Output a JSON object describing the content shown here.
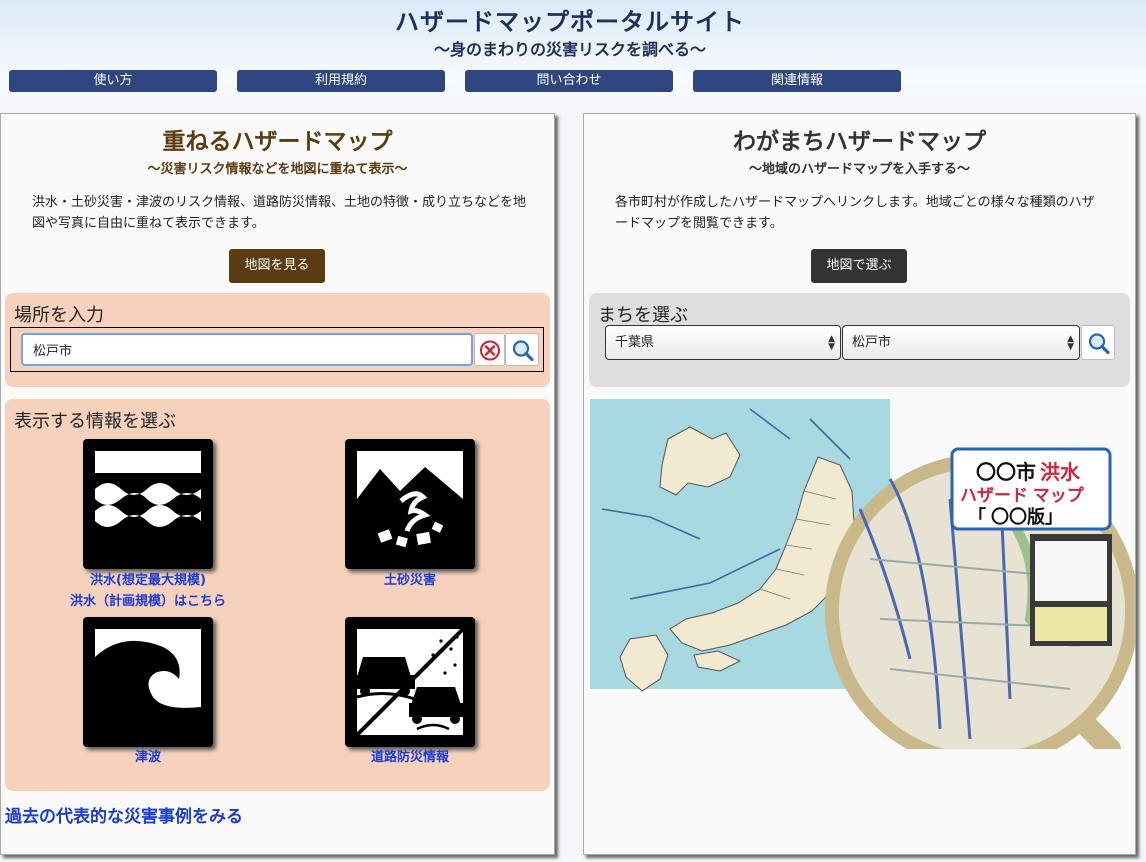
{
  "header": {
    "title": "ハザードマップポータルサイト",
    "subtitle": "〜身のまわりの災害リスクを調べる〜",
    "nav": [
      "使い方",
      "利用規約",
      "問い合わせ",
      "関連情報"
    ]
  },
  "left_panel": {
    "title": "重ねるハザードマップ",
    "subtitle": "〜災害リスク情報などを地図に重ねて表示〜",
    "description": "洪水・土砂災害・津波のリスク情報、道路防災情報、土地の特徴・成り立ちなどを地図や写真に自由に重ねて表示できます。",
    "map_button": "地図を見る",
    "place_box": {
      "title": "場所を入力",
      "input_value": "松戸市",
      "clear_icon": "clear-icon",
      "search_icon": "search-icon"
    },
    "info_box": {
      "title": "表示する情報を選ぶ",
      "items": [
        {
          "label": "洪水(想定最大規模)",
          "label2": "洪水（計画規模）はこちら",
          "icon": "flood-icon"
        },
        {
          "label": "土砂災害",
          "icon": "landslide-icon"
        },
        {
          "label": "津波",
          "icon": "tsunami-icon"
        },
        {
          "label": "道路防災情報",
          "icon": "road-disaster-icon"
        }
      ]
    },
    "past_link": "過去の代表的な災害事例をみる"
  },
  "right_panel": {
    "title": "わがまちハザードマップ",
    "subtitle": "〜地域のハザードマップを入手する〜",
    "description": "各市町村が作成したハザードマップへリンクします。地域ごとの様々な種類のハザードマップを閲覧できます。",
    "map_button": "地図で選ぶ",
    "town_box": {
      "title": "まちを選ぶ",
      "prefecture": "千葉県",
      "city": "松戸市",
      "search_icon": "search-icon"
    },
    "map_image": {
      "sign_line1_a": "〇〇市",
      "sign_line1_b": "洪水",
      "sign_line2": "ハザード マップ",
      "sign_line3": "「 〇〇版」"
    }
  },
  "colors": {
    "nav_button": "#2f4580",
    "left_title": "#5b3c10",
    "left_button": "#5b3c10",
    "right_button": "#333333",
    "orange_box": "#f6d2bd",
    "gray_box": "#dedede",
    "link_blue": "#1a3cd1",
    "sea": "#a8d8e0",
    "land": "#f1ead0"
  }
}
